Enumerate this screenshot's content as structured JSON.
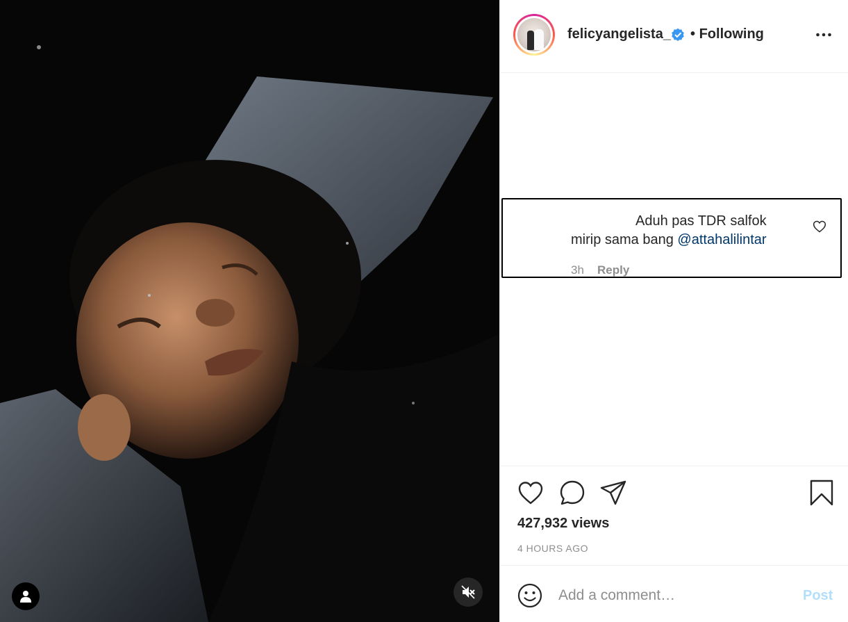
{
  "header": {
    "username": "felicyangelista_",
    "separator": "•",
    "follow_status": "Following",
    "verified_icon": "verified-badge-icon",
    "more_icon": "more-options-icon"
  },
  "comment": {
    "line1": "Aduh pas TDR salfok",
    "line2_prefix": "mirip sama bang ",
    "mention": "@attahalilintar",
    "time": "3h",
    "reply_label": "Reply"
  },
  "stats": {
    "views": "427,932 views",
    "posted": "4 HOURS AGO"
  },
  "composer": {
    "placeholder": "Add a comment…",
    "post_label": "Post"
  },
  "colors": {
    "accent": "#0095f6",
    "post_disabled": "#b2dffc",
    "mention": "#00376b",
    "verified": "#3897f0"
  }
}
